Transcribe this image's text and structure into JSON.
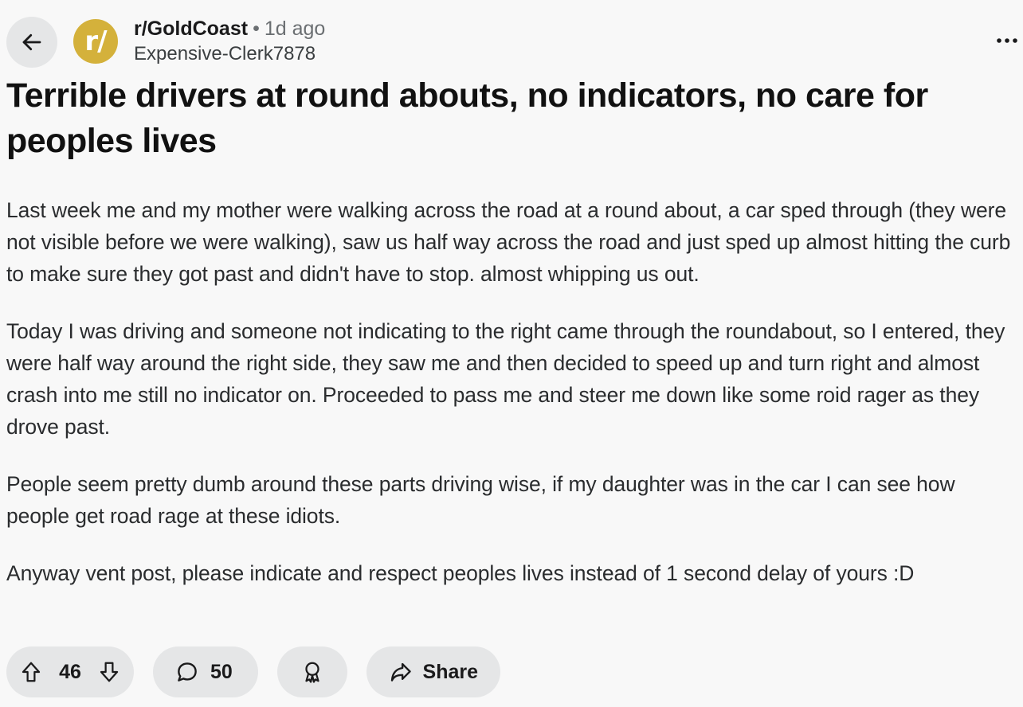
{
  "header": {
    "back_icon": "arrow-left-icon",
    "avatar_text": "r/",
    "avatar_color": "#d4b13b",
    "subreddit": "r/GoldCoast",
    "separator": "•",
    "time": "1d ago",
    "author": "Expensive-Clerk7878",
    "more_icon": "ellipsis-icon"
  },
  "post": {
    "title": "Terrible drivers at round abouts, no indicators, no care for peoples lives",
    "paragraphs": [
      "Last week me and my mother were walking across the road at a round about, a car sped through (they were not visible before we were walking), saw us half way across the road and just sped up almost hitting the curb to make sure they got past and didn't have to stop. almost whipping us out.",
      "Today I was driving and someone not indicating to the right came through the roundabout, so I entered, they were half way around the right side, they saw me and then decided to speed up and turn right and almost crash into me still no indicator on. Proceeded to pass me and steer me down like some roid rager as they drove past.",
      "People seem pretty dumb around these parts driving wise, if my daughter was in the car I can see how people get road rage at these idiots.",
      "Anyway vent post, please indicate and respect peoples lives instead of 1 second delay of yours :D"
    ]
  },
  "actions": {
    "score": "46",
    "upvote_icon": "upvote-arrow-icon",
    "downvote_icon": "downvote-arrow-icon",
    "comments": "50",
    "comment_icon": "comment-bubble-icon",
    "award_icon": "award-icon",
    "share_icon": "share-arrow-icon",
    "share_label": "Share"
  },
  "colors": {
    "background": "#f8f8f8",
    "pill_background": "#e5e6e7",
    "text": "#1a1a1b",
    "muted_text": "#6b6f72"
  }
}
